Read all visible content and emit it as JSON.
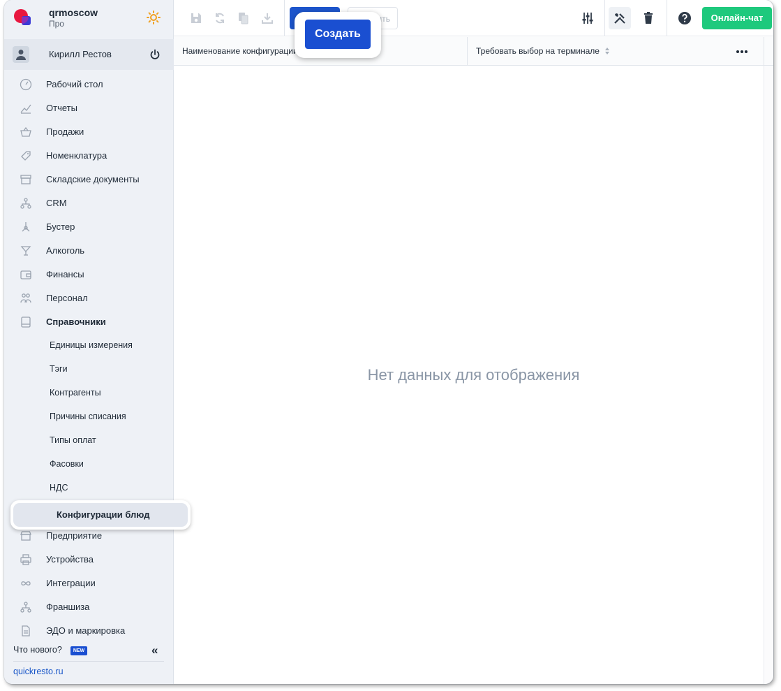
{
  "org": {
    "name": "qrmoscow",
    "plan": "Про"
  },
  "user": {
    "name": "Кирилл Рестов"
  },
  "nav": {
    "items": [
      {
        "label": "Рабочий стол",
        "icon": "dashboard-icon"
      },
      {
        "label": "Отчеты",
        "icon": "reports-icon"
      },
      {
        "label": "Продажи",
        "icon": "basket-icon"
      },
      {
        "label": "Номенклатура",
        "icon": "tag-icon"
      },
      {
        "label": "Складские документы",
        "icon": "warehouse-icon"
      },
      {
        "label": "CRM",
        "icon": "crm-icon"
      },
      {
        "label": "Бустер",
        "icon": "booster-icon"
      },
      {
        "label": "Алкоголь",
        "icon": "glass-icon"
      },
      {
        "label": "Финансы",
        "icon": "wallet-icon"
      },
      {
        "label": "Персонал",
        "icon": "people-icon"
      },
      {
        "label": "Справочники",
        "icon": "book-icon"
      }
    ],
    "sub_items": [
      {
        "label": "Единицы измерения"
      },
      {
        "label": "Тэги"
      },
      {
        "label": "Контрагенты"
      },
      {
        "label": "Причины списания"
      },
      {
        "label": "Типы оплат"
      },
      {
        "label": "Фасовки"
      },
      {
        "label": "НДС"
      }
    ],
    "active_label": "Конфигурации блюд",
    "bottom_items": [
      {
        "label": "Предприятие",
        "icon": "store-icon"
      },
      {
        "label": "Устройства",
        "icon": "printer-icon"
      },
      {
        "label": "Интеграции",
        "icon": "infinity-icon"
      },
      {
        "label": "Франшиза",
        "icon": "franchise-icon"
      },
      {
        "label": "ЭДО и маркировка",
        "icon": "document-icon"
      }
    ]
  },
  "footer": {
    "whats_new": "Что нового?",
    "badge": "NEW",
    "collapse": "«",
    "site": "quickresto.ru"
  },
  "toolbar": {
    "create_label": "Создать",
    "ghost_label": "ить",
    "chat_label": "Онлайн-чат"
  },
  "table": {
    "columns": [
      "Наименование конфигурации",
      "Требовать выбор на терминале"
    ],
    "empty_text": "Нет данных для отображения"
  },
  "colors": {
    "accent": "#1a4fd1",
    "chat": "#1ec97d",
    "sidebar": "#eef1f6",
    "logo_red": "#e8173f"
  }
}
